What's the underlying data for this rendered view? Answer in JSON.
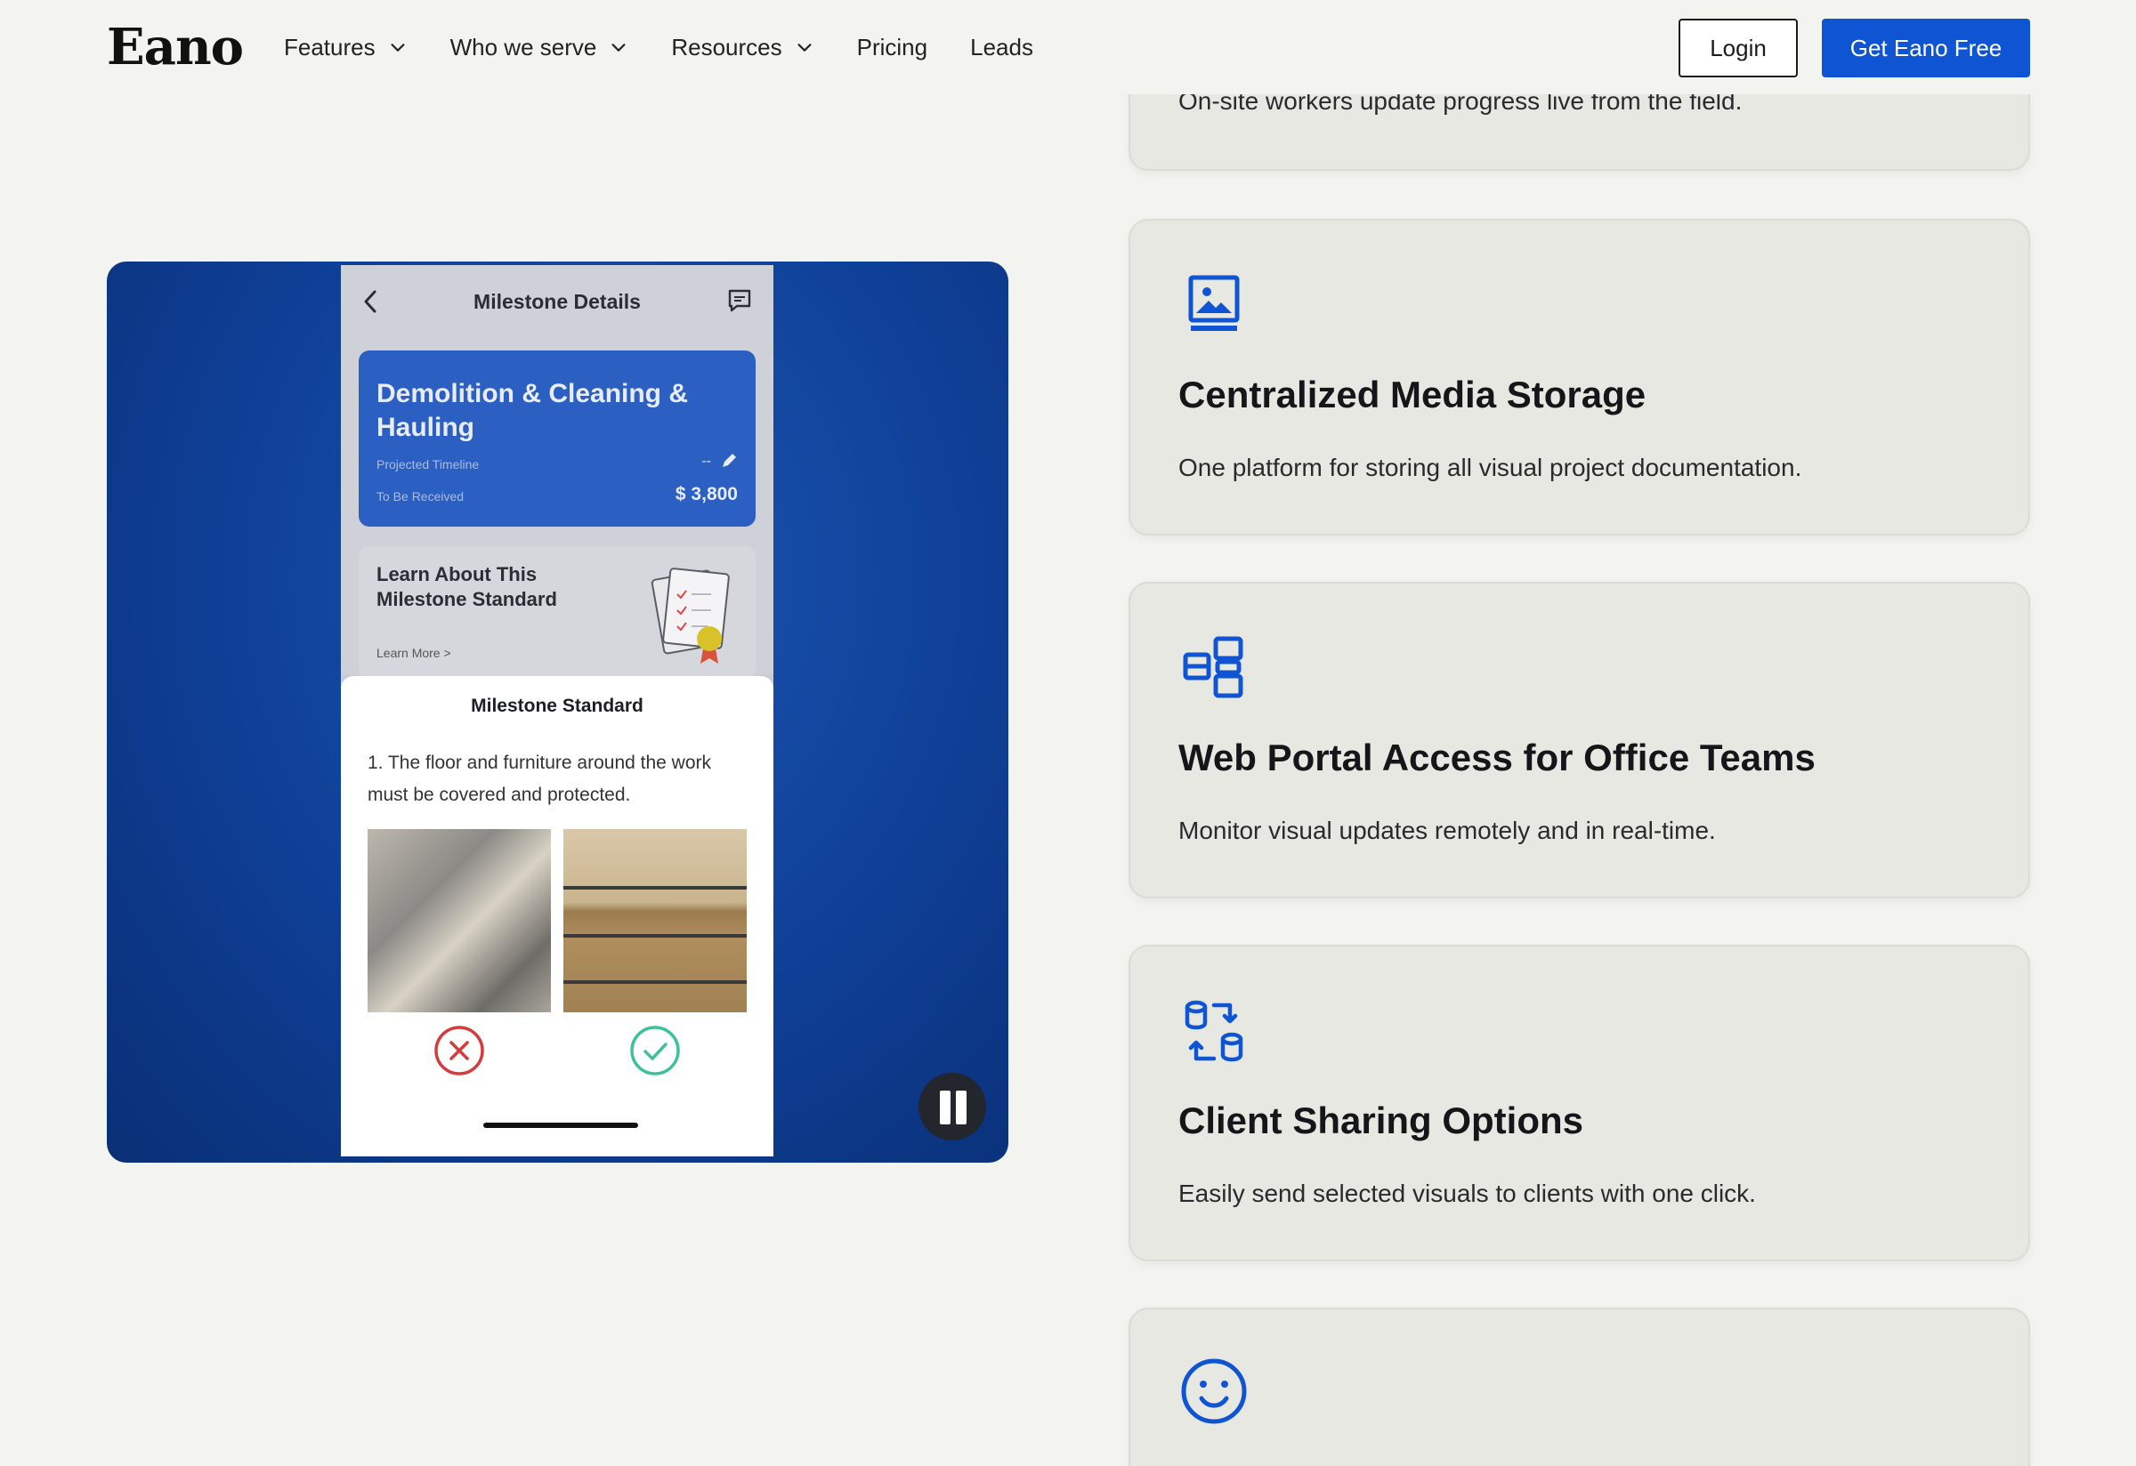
{
  "header": {
    "logo": "Eano",
    "nav": [
      {
        "label": "Features",
        "has_dropdown": true
      },
      {
        "label": "Who we serve",
        "has_dropdown": true
      },
      {
        "label": "Resources",
        "has_dropdown": true
      },
      {
        "label": "Pricing",
        "has_dropdown": false
      },
      {
        "label": "Leads",
        "has_dropdown": false
      }
    ],
    "login_label": "Login",
    "cta_label": "Get Eano Free",
    "cta_color": "#0f54d2"
  },
  "video": {
    "phone_title": "Milestone Details",
    "milestone_card": {
      "title": "Demolition & Cleaning & Hauling",
      "timeline_label": "Projected Timeline",
      "timeline_value": "--",
      "receive_label": "To Be Received",
      "amount": "$ 3,800"
    },
    "learn_card": {
      "title": "Learn About This Milestone Standard",
      "link": "Learn More >"
    },
    "sheet": {
      "title": "Milestone Standard",
      "text": "1. The floor and furniture around the work must be covered and protected."
    },
    "control": "pause-icon"
  },
  "features": [
    {
      "title": "",
      "description": "On-site workers update progress live from the field.",
      "icon": "partial"
    },
    {
      "title": "Centralized Media Storage",
      "description": "One platform for storing all visual project documentation.",
      "icon": "image-icon"
    },
    {
      "title": "Web Portal Access for Office Teams",
      "description": "Monitor visual updates remotely and in real-time.",
      "icon": "portal-icon"
    },
    {
      "title": "Client Sharing Options",
      "description": "Easily send selected visuals to clients with one click.",
      "icon": "share-icon"
    },
    {
      "title": "",
      "description": "",
      "icon": "smiley-icon"
    }
  ],
  "accent_color": "#0f54d2"
}
